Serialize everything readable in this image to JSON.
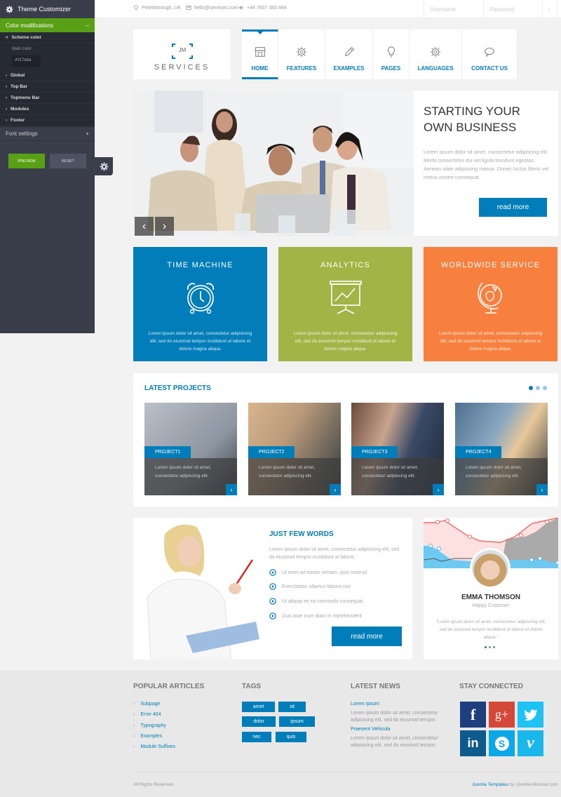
{
  "topbar": {
    "location": "Peterborough, UK",
    "email": "hello@services.com",
    "phone": "+44 7837 383 484",
    "username_placeholder": "Username",
    "password_placeholder": "Password",
    "submit_icon": "chevron-right"
  },
  "logo": {
    "mark": "JM",
    "name": "SERVICES"
  },
  "nav": {
    "items": [
      {
        "label": "HOME",
        "icon": "store-icon",
        "active": true
      },
      {
        "label": "FEATURES",
        "icon": "gear-icon"
      },
      {
        "label": "EXAMPLES",
        "icon": "pencil-icon"
      },
      {
        "label": "PAGES",
        "icon": "lightbulb-icon"
      },
      {
        "label": "LANGUAGES",
        "icon": "gear-icon"
      },
      {
        "label": "CONTACT US",
        "icon": "speech-bubble-icon"
      }
    ]
  },
  "hero": {
    "title_line1": "STARTING YOUR",
    "title_line2": "OWN BUSINESS",
    "text": "Lorem ipsum dolor sit amet, consectetur adipiscing elit. Morbi consectetur dui vel ligula tincidunt egestas. Aenean vitae adipiscing massa. Donec luctus libero vel metus ornare consequat.",
    "button": "read more",
    "prev": "‹",
    "next": "›"
  },
  "features": [
    {
      "title": "TIME MACHINE",
      "icon": "alarm-clock-icon",
      "color": "#017eba",
      "text": "Lorem ipsum dolor sit amet, consectetur adipisicing elit, sed do eiusmod tempor incididunt ut labore et dolore magna aliqua."
    },
    {
      "title": "ANALYTICS",
      "icon": "presentation-chart-icon",
      "color": "#a3b446",
      "text": "Lorem ipsum dolor sit amet, consectetur adipisicing elit, sed do eiusmod tempor incididunt ut labore et dolore magna aliqua."
    },
    {
      "title": "WORLDWIDE SERVICE",
      "icon": "globe-icon",
      "color": "#f7803f",
      "text": "Lorem ipsum dolor sit amet, consectetur adipisicing elit, sed do eiusmod tempor incididunt ut labore et dolore magna aliqua."
    }
  ],
  "projects": {
    "title": "LATEST PROJECTS",
    "pager_active": 1,
    "pager_count": 3,
    "items": [
      {
        "label": "PROJECT1",
        "text": "Lorem ipsum dolor sit amet, consectetur adipiscing elit."
      },
      {
        "label": "PROJECT2",
        "text": "Lorem ipsum dolor sit amet, consectetur adipiscing elit."
      },
      {
        "label": "PROJECT3",
        "text": "Lorem ipsum dolor sit amet, consectetur adipiscing elit."
      },
      {
        "label": "PROJECT4",
        "text": "Lorem ipsum dolor sit amet, consectetur adipiscing elit."
      }
    ]
  },
  "words": {
    "title": "JUST FEW WORDS",
    "intro": "Lorem ipsum dolor sit amet, consectetur adipisicing elit, sed do eiusmod tempor incididunt ut labore.",
    "list": [
      "Ut enim ad minim veniam, quis nostrud",
      "Exercitation ullamco laboris nisi",
      "Ut aliquip ex ea commodo consequat.",
      "Duis aute irure dolor in reprehenderit"
    ],
    "button": "read more"
  },
  "testimonial": {
    "name": "EMMA THOMSON",
    "role": "Happy Customer",
    "quote": "\"Lorem ipsum dolor sit amet, consectetur adipisicing elit, sed do eiusmod tempor incididunt ut labore et dolore aliqua.\"",
    "pager_active": 1,
    "pager_count": 3
  },
  "footer": {
    "popular": {
      "title": "POPULAR ARTICLES",
      "items": [
        "Subpage",
        "Error 404",
        "Typography",
        "Examples",
        "Module Suffixes"
      ]
    },
    "tags": {
      "title": "TAGS",
      "items": [
        "amet",
        "sit",
        "dolor",
        "ipsum",
        "nec",
        "quis"
      ]
    },
    "news": {
      "title": "LATEST NEWS",
      "items": [
        {
          "title": "Lorem Ipsum",
          "text": "Lorem ipsum dolor sit amet, consectetur adipisicing elit, sed do eiusmod tempor."
        },
        {
          "title": "Praesent Vehicula",
          "text": "Lorem ipsum dolor sit amet, consectetur adipisicing elit, sed do eiusmod tempor."
        }
      ]
    },
    "social": {
      "title": "STAY CONNECTED",
      "items": [
        {
          "name": "facebook",
          "glyph": "f",
          "color": "#1e3f7d"
        },
        {
          "name": "google-plus",
          "glyph": "g+",
          "color": "#d34836"
        },
        {
          "name": "twitter",
          "glyph": "🐦",
          "color": "#1ec2f3"
        },
        {
          "name": "linkedin",
          "glyph": "in",
          "color": "#0d5a8c"
        },
        {
          "name": "skype",
          "glyph": "S",
          "color": "#0ca8e5"
        },
        {
          "name": "vimeo",
          "glyph": "v",
          "color": "#1ab7ea"
        }
      ]
    },
    "copyright": "All Rights Reserved.",
    "credit_link": "Joomla Templates",
    "credit_rest": " by Joomla-Monster.com"
  },
  "customizer": {
    "title": "Theme Customizer",
    "section": "Color modifications",
    "section_toggle": "−",
    "items": [
      {
        "label": "Scheme color",
        "expanded": true
      },
      {
        "label": "Global"
      },
      {
        "label": "Top Bar"
      },
      {
        "label": "Topmenu Bar"
      },
      {
        "label": "Modules"
      },
      {
        "label": "Footer"
      }
    ],
    "main_color_label": "Main color",
    "main_color_value": "#017eba",
    "font_settings": "Font settings",
    "font_toggle": "+",
    "preview": "PREVIEW",
    "reset": "RESET"
  },
  "colors": {
    "accent": "#017eba",
    "customizer_green": "#5aa016",
    "customizer_bg": "#3a3e4a"
  }
}
